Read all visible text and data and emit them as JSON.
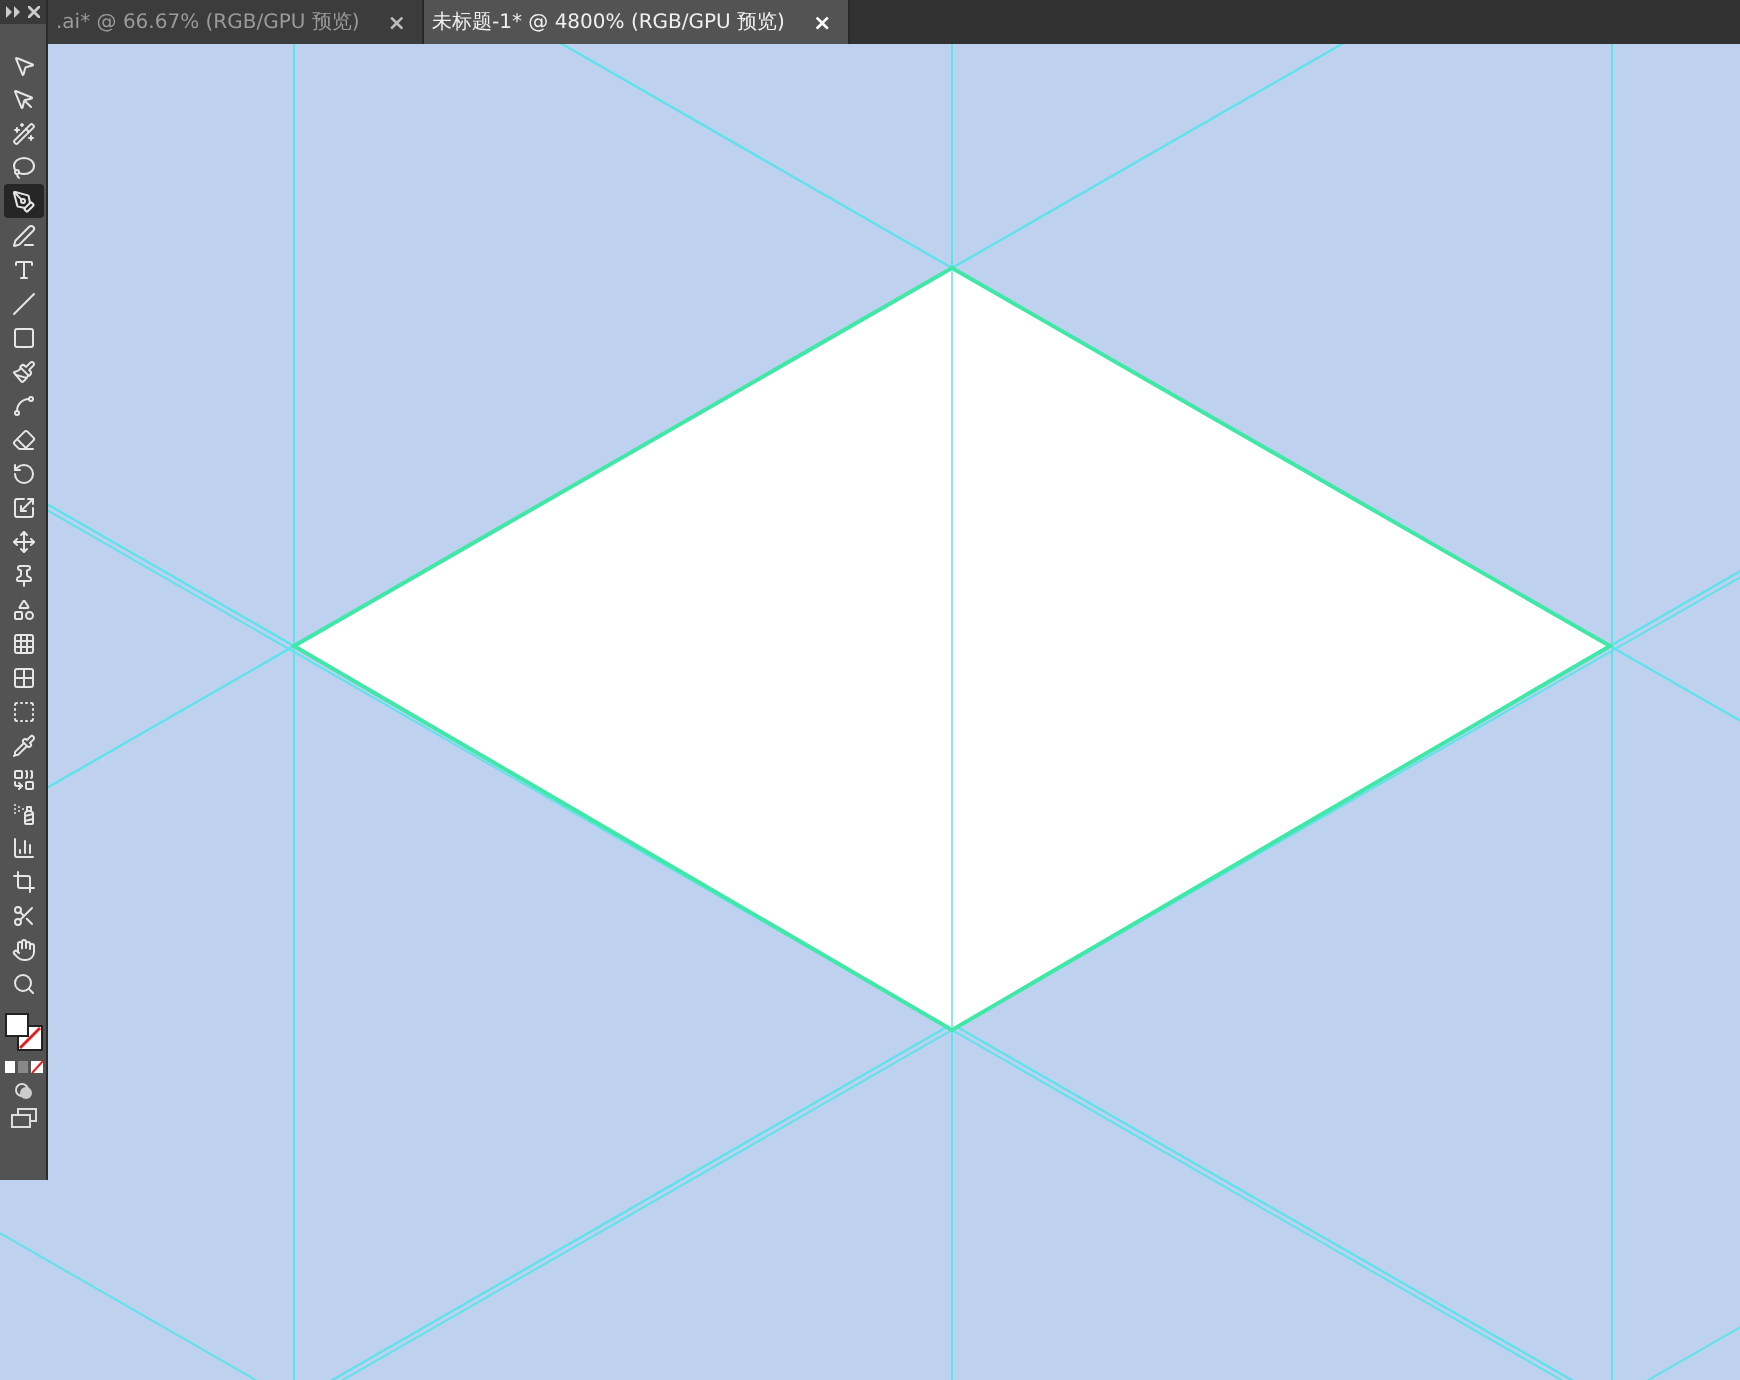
{
  "tabs": [
    {
      "title": ".ai* @ 66.67% (RGB/GPU 预览)",
      "close": "×",
      "selected": false
    },
    {
      "title": "未标题-1* @ 4800% (RGB/GPU 预览)",
      "close": "×",
      "selected": true
    }
  ],
  "tools": [
    {
      "selected": false
    },
    {
      "selected": false
    },
    {
      "selected": false
    },
    {
      "selected": false
    },
    {
      "selected": true
    },
    {
      "selected": false
    },
    {
      "selected": false
    },
    {
      "selected": false
    },
    {
      "selected": false
    },
    {
      "selected": false
    },
    {
      "selected": false
    },
    {
      "selected": false
    },
    {
      "selected": false
    },
    {
      "selected": false
    },
    {
      "selected": false
    },
    {
      "selected": false
    },
    {
      "selected": false
    },
    {
      "selected": false
    },
    {
      "selected": false
    },
    {
      "selected": false
    },
    {
      "selected": false
    },
    {
      "selected": false
    },
    {
      "selected": false
    },
    {
      "selected": false
    },
    {
      "selected": false
    },
    {
      "selected": false
    },
    {
      "selected": false
    },
    {
      "selected": false
    }
  ]
}
